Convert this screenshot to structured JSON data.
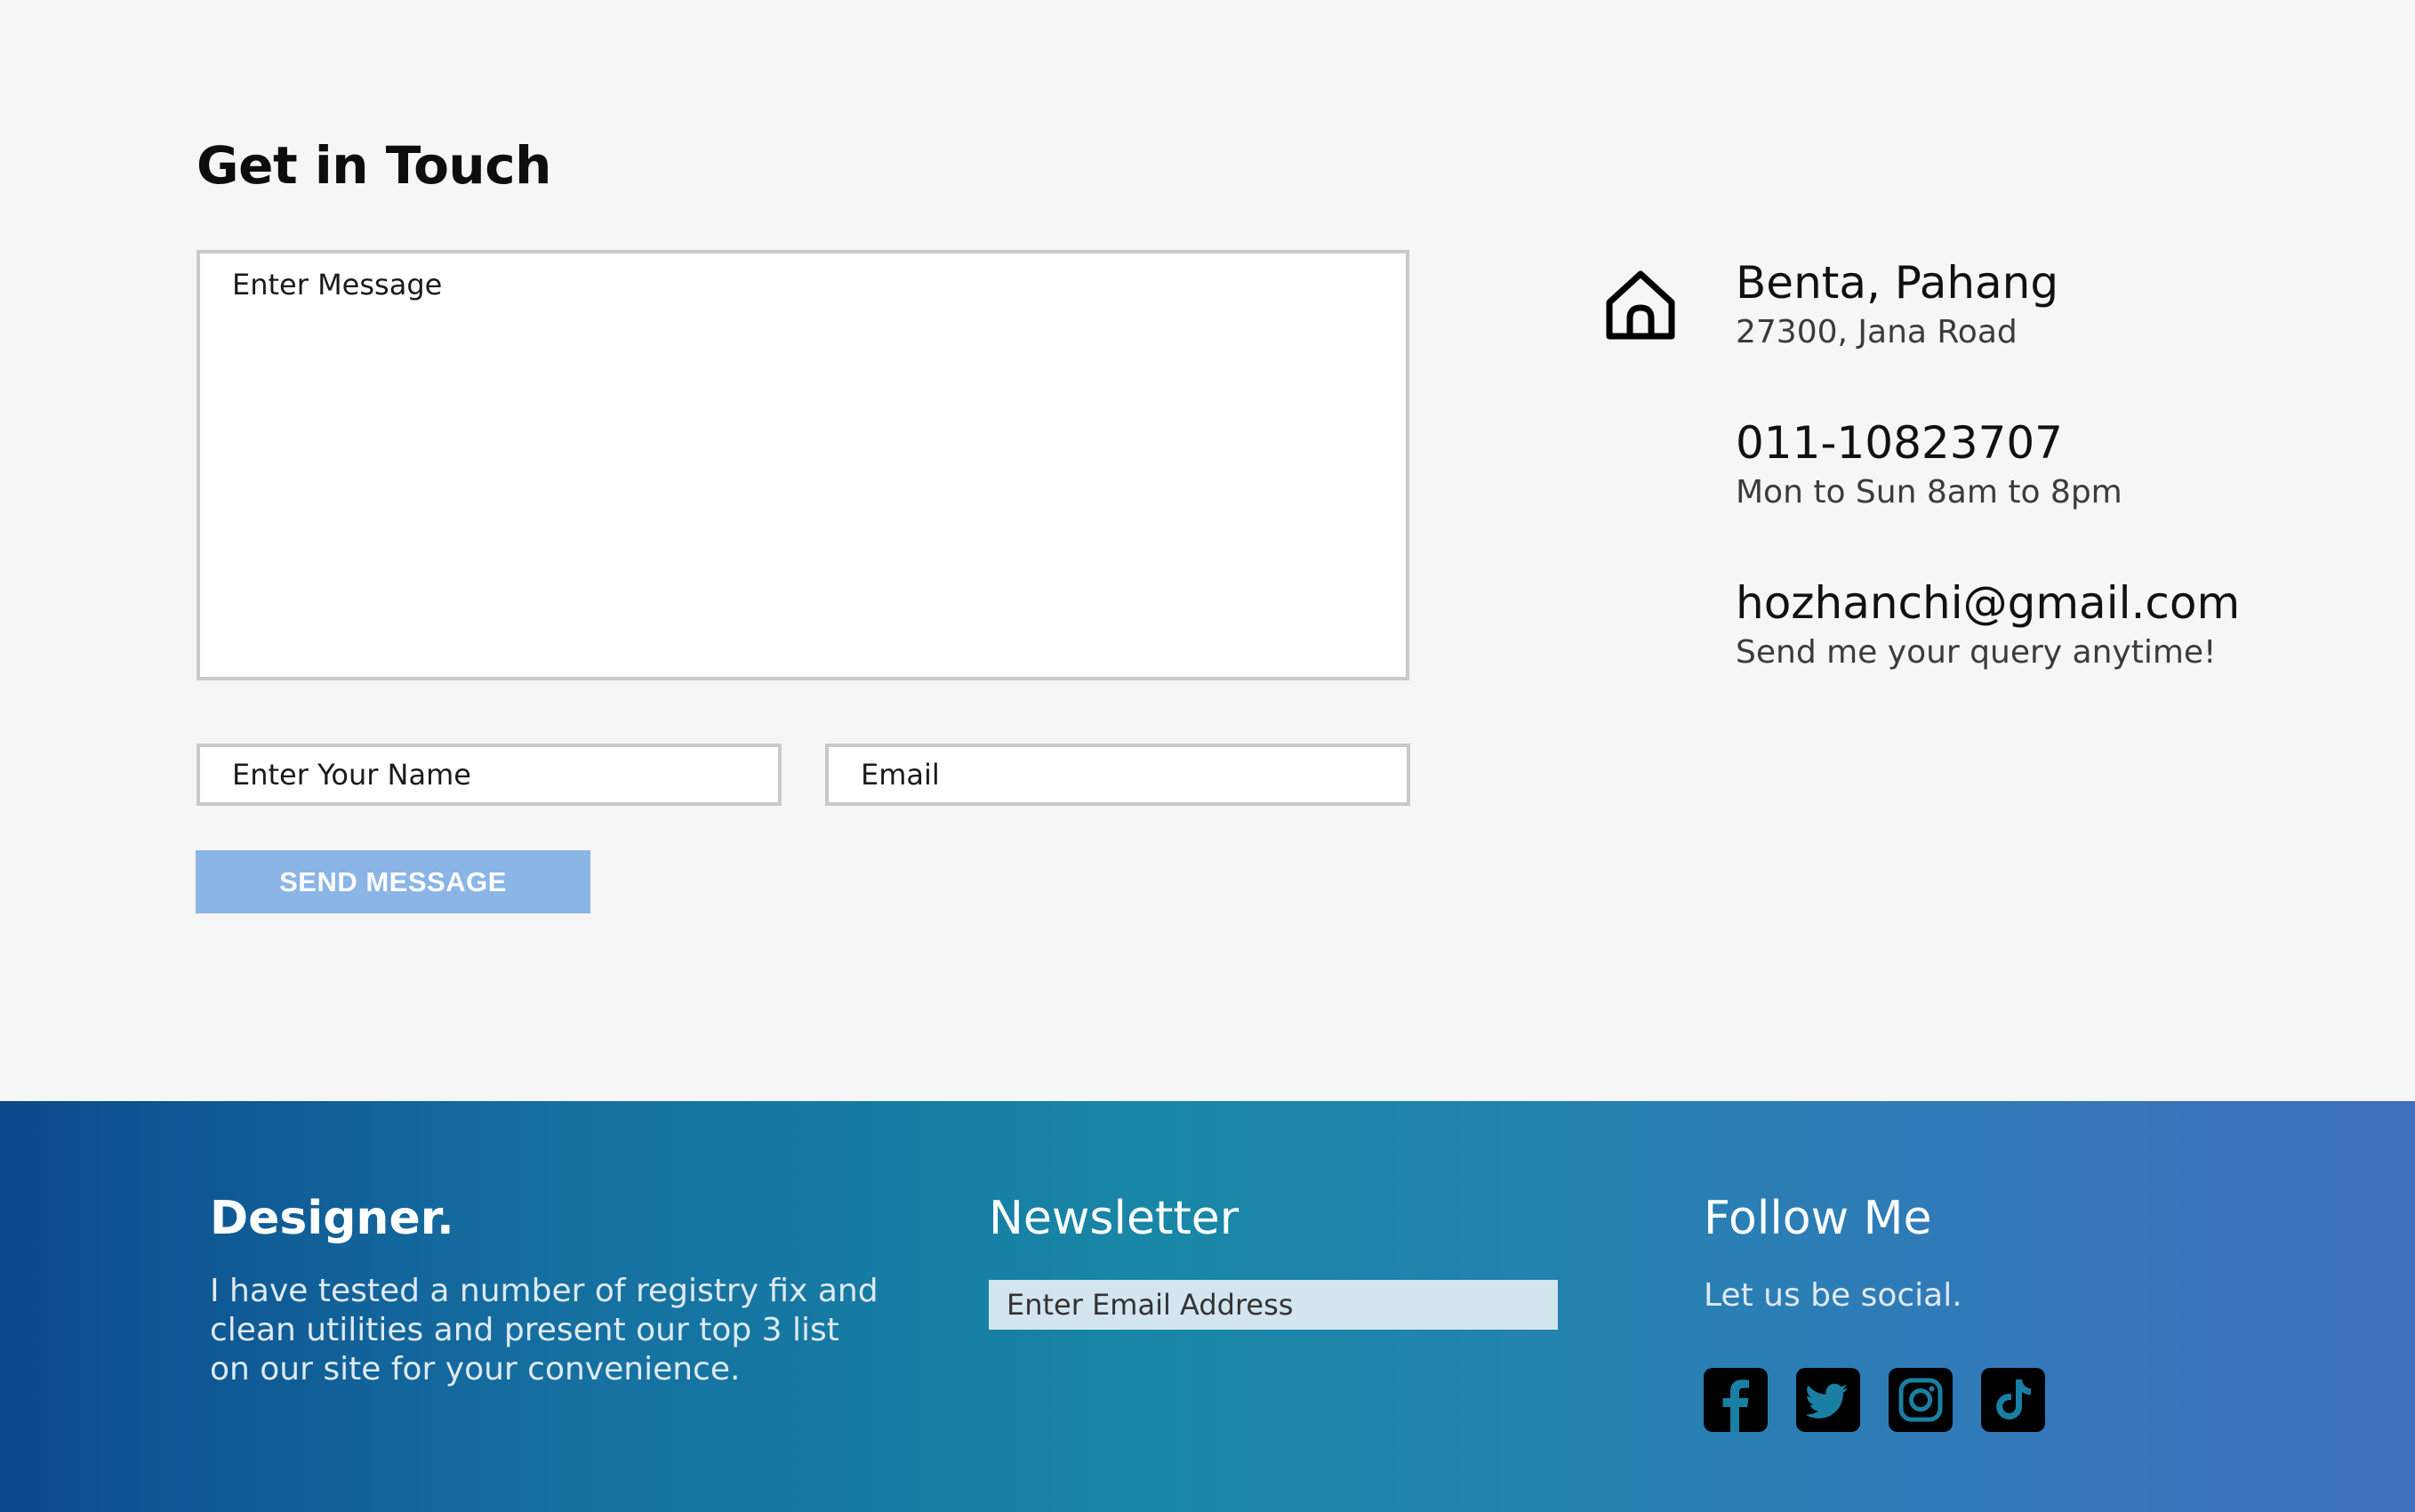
{
  "contact": {
    "title": "Get in Touch",
    "message_placeholder": "Enter Message",
    "name_placeholder": "Enter Your Name",
    "email_placeholder": "Email",
    "send_label": "SEND MESSAGE",
    "send_color": "#8ab5e6",
    "info": [
      {
        "icon": "home-icon",
        "main": "Benta, Pahang",
        "sub": "27300, Jana Road"
      },
      {
        "main": "011-10823707",
        "sub": "Mon to Sun 8am to 8pm"
      },
      {
        "main": "hozhanchi@gmail.com",
        "sub": "Send me your query anytime!"
      }
    ]
  },
  "footer": {
    "brand": "Designer.",
    "about": "I have tested a number of registry fix and clean utilities and present our top 3 list on our site for your convenience.",
    "newsletter_title": "Newsletter",
    "newsletter_placeholder": "Enter Email Address",
    "follow_title": "Follow Me",
    "follow_text": "Let us be social.",
    "social": [
      "facebook-icon",
      "twitter-icon",
      "instagram-icon",
      "tiktok-icon"
    ],
    "gradient": [
      "#0b4a8c",
      "#1887a6",
      "#3f6fbf"
    ]
  }
}
